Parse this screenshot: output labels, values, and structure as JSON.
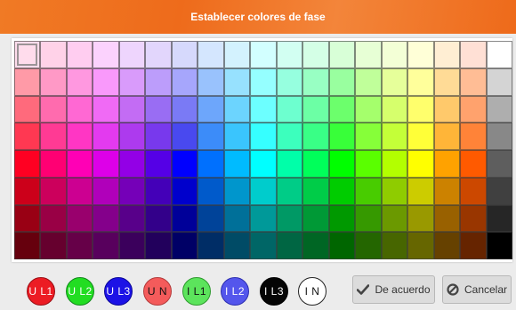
{
  "dialog": {
    "title": "Establecer colores de fase"
  },
  "palette": {
    "rows": [
      [
        "#ffdcec",
        "#ffd2e8",
        "#ffcdf0",
        "#fbd2fd",
        "#eed5fd",
        "#e2d6fc",
        "#d6d9fc",
        "#d4e6fe",
        "#d3f2fe",
        "#d2ffff",
        "#d2fff2",
        "#d4ffe6",
        "#d8ffd7",
        "#e7ffd5",
        "#f3ffd6",
        "#ffffd7",
        "#ffeed3",
        "#ffe0d5",
        "#ffffff"
      ],
      [
        "#ff9aa7",
        "#ff99c6",
        "#ff98e0",
        "#f999fb",
        "#d99bfb",
        "#bc9dfb",
        "#a6a6fc",
        "#99c2fd",
        "#97e1fe",
        "#95ffff",
        "#96ffdf",
        "#98ffc3",
        "#99ff9f",
        "#c0ff9a",
        "#e6ff9a",
        "#ffff9b",
        "#ffdb96",
        "#ffbd95",
        "#d4d4d4"
      ],
      [
        "#ff6a7c",
        "#ff6bae",
        "#ff68d3",
        "#f06af5",
        "#c36cf4",
        "#996df3",
        "#7a7af5",
        "#6da6fb",
        "#6cd4fe",
        "#6cffff",
        "#6dffcf",
        "#6cffa5",
        "#6cff6c",
        "#a5ff6c",
        "#d6ff6c",
        "#ffff6c",
        "#ffc96b",
        "#ffa26d",
        "#aeaeae"
      ],
      [
        "#ff3852",
        "#ff3a94",
        "#ff36c4",
        "#e33aef",
        "#ad3aee",
        "#7839ed",
        "#4949ef",
        "#3c8cf9",
        "#3ac5fd",
        "#36ffff",
        "#3cffbd",
        "#39ff86",
        "#38ff39",
        "#86ff39",
        "#c4ff38",
        "#ffff38",
        "#ffb538",
        "#ff8338",
        "#888888"
      ],
      [
        "#ff0022",
        "#ff0073",
        "#ff00b5",
        "#dd00e8",
        "#9300e6",
        "#5500e6",
        "#0000ff",
        "#0070fe",
        "#00bbff",
        "#00ffff",
        "#00ffa9",
        "#00ff5a",
        "#00ff00",
        "#5aff00",
        "#b3ff00",
        "#ffff00",
        "#ffa200",
        "#ff5a00",
        "#5e5e5e"
      ],
      [
        "#cc001a",
        "#cc005c",
        "#cc0091",
        "#b000ba",
        "#7500b8",
        "#4400b8",
        "#0000cc",
        "#005acb",
        "#0096cc",
        "#00cccc",
        "#00cc87",
        "#00cc48",
        "#00cc00",
        "#48cc00",
        "#8fcc00",
        "#cccc00",
        "#cc8200",
        "#cc4800",
        "#404040"
      ],
      [
        "#990014",
        "#990045",
        "#99006d",
        "#84008b",
        "#58008a",
        "#33008a",
        "#000099",
        "#004399",
        "#007099",
        "#009999",
        "#009965",
        "#009936",
        "#009900",
        "#369900",
        "#6b9900",
        "#999900",
        "#996100",
        "#993600",
        "#262626"
      ],
      [
        "#66000d",
        "#66002e",
        "#660048",
        "#58005d",
        "#3b005c",
        "#22005c",
        "#000066",
        "#002d66",
        "#004b66",
        "#006666",
        "#006643",
        "#006624",
        "#006600",
        "#246600",
        "#476600",
        "#666600",
        "#664100",
        "#662400",
        "#000000"
      ]
    ],
    "selected": "row 0, column 0"
  },
  "phases": [
    {
      "label": "U L1",
      "name": "phase-u-l1",
      "fill": "#ec1c24",
      "text": "#ffffff",
      "border": "#9a0e14"
    },
    {
      "label": "U L2",
      "name": "phase-u-l2",
      "fill": "#22dd22",
      "text": "#ffffff",
      "border": "#11881b"
    },
    {
      "label": "U L3",
      "name": "phase-u-l3",
      "fill": "#1c12e6",
      "text": "#ffffff",
      "border": "#0a0699"
    },
    {
      "label": "U N",
      "name": "phase-u-n",
      "fill": "#f45b5b",
      "text": "#111111",
      "border": "#b33a3a"
    },
    {
      "label": "I L1",
      "name": "phase-i-l1",
      "fill": "#5ce45c",
      "text": "#111111",
      "border": "#2d9a2d"
    },
    {
      "label": "I L2",
      "name": "phase-i-l2",
      "fill": "#5456ec",
      "text": "#ffffff",
      "border": "#2c2eb0"
    },
    {
      "label": "I L3",
      "name": "phase-i-l3",
      "fill": "#050505",
      "text": "#ffffff",
      "border": "#000000"
    },
    {
      "label": "I N",
      "name": "phase-i-n",
      "fill": "#ffffff",
      "text": "#111111",
      "border": "#222222"
    }
  ],
  "buttons": {
    "ok": {
      "label": "De acuerdo",
      "icon": "checkmark-icon"
    },
    "cancel": {
      "label": "Cancelar",
      "icon": "cancel-circle-icon"
    }
  }
}
